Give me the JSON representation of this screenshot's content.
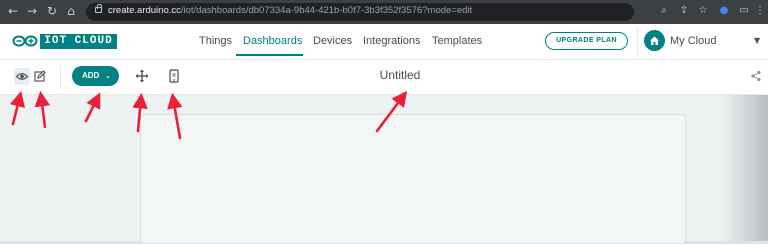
{
  "browser": {
    "url_host": "create.arduino.cc",
    "url_path": "/iot/dashboards/db07334a-9b44-421b-b0f7-3b3f352f3576?mode=edit"
  },
  "header": {
    "logo_text": "IOT CLOUD",
    "nav": [
      {
        "label": "Things",
        "active": false
      },
      {
        "label": "Dashboards",
        "active": true
      },
      {
        "label": "Devices",
        "active": false
      },
      {
        "label": "Integrations",
        "active": false
      },
      {
        "label": "Templates",
        "active": false
      }
    ],
    "upgrade_label": "UPGRADE PLAN",
    "space_label": "My Cloud"
  },
  "toolbar": {
    "add_label": "ADD",
    "dashboard_title": "Untitled"
  },
  "colors": {
    "accent": "#008184",
    "arrow": "#e8203a"
  }
}
